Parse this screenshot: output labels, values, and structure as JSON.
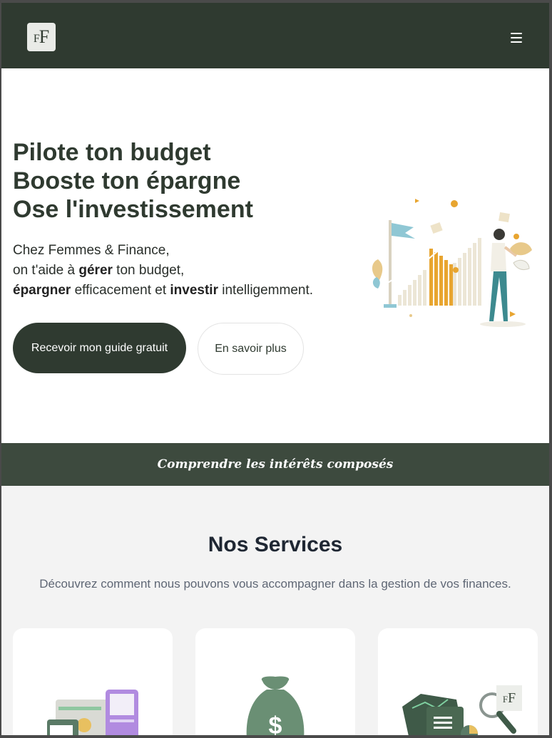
{
  "header": {
    "logo_small": "F",
    "logo_big": "F",
    "menu_icon": "hamburger-icon"
  },
  "hero": {
    "title_lines": [
      "Pilote ton budget",
      "Booste ton épargne",
      "Ose l'investissement"
    ],
    "desc_line1": "Chez Femmes & Finance,",
    "desc_line2_pre": "on t'aide à ",
    "desc_line2_bold": "gérer",
    "desc_line2_post": " ton budget,",
    "desc_line3_bold1": "épargner",
    "desc_line3_mid": " efficacement et ",
    "desc_line3_bold2": "investir",
    "desc_line3_post": " intelligemment.",
    "primary_button": "Recevoir mon guide gratuit",
    "secondary_button": "En savoir plus"
  },
  "banner": {
    "text": "Comprendre les intérêts composés"
  },
  "services": {
    "title": "Nos Services",
    "description": "Découvrez comment nous pouvons vous accompagner dans la gestion de vos finances.",
    "cards": [
      {
        "icon": "dashboard-illustration-icon"
      },
      {
        "icon": "money-bag-icon"
      },
      {
        "icon": "report-analysis-icon"
      }
    ]
  },
  "colors": {
    "brand_dark": "#2f3a30",
    "banner": "#3d4a3e",
    "accent_gold": "#e8a530",
    "accent_teal": "#5fb3c4"
  }
}
